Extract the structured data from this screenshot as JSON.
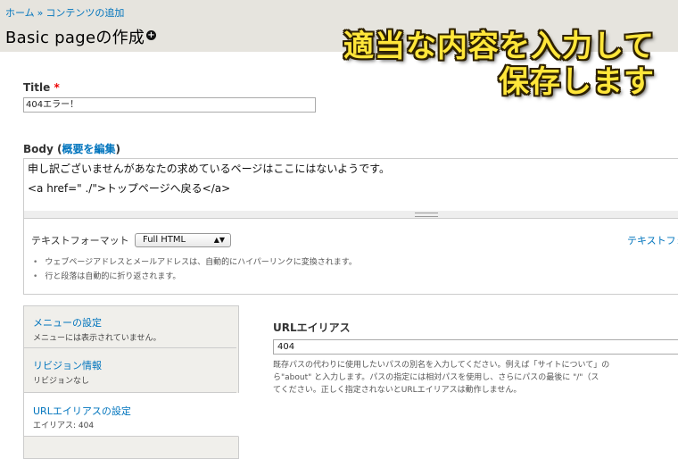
{
  "breadcrumb": {
    "home": "ホーム",
    "sep": "»",
    "current": "コンテンツの追加"
  },
  "page_title": "Basic pageの作成",
  "shortcut_icon": "+",
  "annotation": {
    "line1": "適当な内容を入力して",
    "line2": "保存します"
  },
  "title_field": {
    "label": "Title",
    "required_mark": "*",
    "value": "404エラー！"
  },
  "body_field": {
    "label": "Body",
    "paren_open": "(",
    "summary_link": "概要を編集",
    "paren_close": ")",
    "line1": "申し訳ございませんがあなたの求めているページはここにはないようです。",
    "line2": "<a href=\" ./\">トップページへ戻る</a>"
  },
  "text_format": {
    "label": "テキストフォーマット",
    "selected": "Full HTML",
    "help_link": "テキストフォ",
    "tips": [
      "ウェブページアドレスとメールアドレスは、自動的にハイパーリンクに変換されます。",
      "行と段落は自動的に折り返されます。"
    ]
  },
  "vertical_tabs": [
    {
      "title": "メニューの設定",
      "summary": "メニューには表示されていません。"
    },
    {
      "title": "リビジョン情報",
      "summary": "リビジョンなし"
    },
    {
      "title": "URLエイリアスの設定",
      "summary": "エイリアス: 404"
    }
  ],
  "url_alias": {
    "label": "URLエイリアス",
    "value": "404",
    "desc_line1": "既存パスの代わりに使用したいパスの別名を入力してください。例えば「サイトについて」の",
    "desc_line2": "ら\"about\" と入力します。パスの指定には相対パスを使用し、さらにパスの最後に \"/\"（ス",
    "desc_line3": "てください。正しく指定されないとURLエイリアスは動作しません。"
  }
}
